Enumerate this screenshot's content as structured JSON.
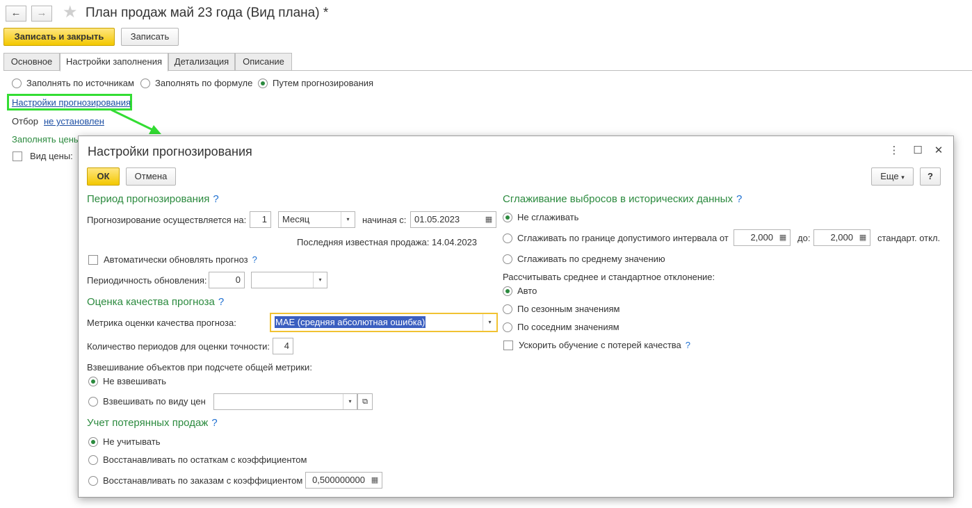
{
  "window": {
    "title": "План продаж май 23 года (Вид плана) *",
    "back_glyph": "←",
    "forward_glyph": "→",
    "star_glyph": "★"
  },
  "toolbar": {
    "save_close_label": "Записать и закрыть",
    "save_label": "Записать"
  },
  "tabs": [
    {
      "label": "Основное",
      "active": false
    },
    {
      "label": "Настройки заполнения",
      "active": true
    },
    {
      "label": "Детализация",
      "active": false
    },
    {
      "label": "Описание",
      "active": false
    }
  ],
  "fill_mode": {
    "options": [
      "Заполнять по источникам",
      "Заполнять по формуле",
      "Путем прогнозирования"
    ],
    "selected": 2
  },
  "forecast_settings_link": "Настройки прогнозирования",
  "filter": {
    "label": "Отбор",
    "value_link": "не установлен"
  },
  "fill_prices_label": "Заполнять цены",
  "price_type_label": "Вид цены:",
  "dialog": {
    "title": "Настройки прогнозирования",
    "more_glyph": "⋮",
    "maximize_glyph": "☐",
    "close_glyph": "✕",
    "ok_label": "ОК",
    "cancel_label": "Отмена",
    "more_label": "Еще",
    "more_arrow": "▾",
    "help_label": "?",
    "question_glyph": "?",
    "dropdown_glyph": "▾",
    "calc_glyph": "▦",
    "open_glyph": "⧉",
    "period": {
      "heading": "Период прогнозирования",
      "forecast_label": "Прогнозирование осуществляется на:",
      "count": "1",
      "unit": "Месяц",
      "start_label": "начиная с:",
      "start_date": "01.05.2023",
      "calendar_glyph": "▦",
      "last_sale": "Последняя известная продажа:  14.04.2023",
      "auto_update_label": "Автоматически обновлять прогноз",
      "update_period_label": "Периодичность обновления:",
      "update_period_value": "0",
      "update_period_unit": ""
    },
    "quality": {
      "heading": "Оценка качества прогноза",
      "metric_label": "Метрика оценки качества прогноза:",
      "metric_value": "MAE (средняя абсолютная ошибка)",
      "periods_label": "Количество периодов для оценки точности:",
      "periods_value": "4",
      "weighting_label": "Взвешивание объектов при подсчете общей метрики:",
      "weighting_options": [
        "Не взвешивать",
        "Взвешивать по виду цен"
      ],
      "weighting_selected": 0,
      "price_type_value": ""
    },
    "lost_sales": {
      "heading": "Учет потерянных продаж",
      "options": [
        "Не учитывать",
        "Восстанавливать по остаткам с коэффициентом",
        "Восстанавливать по заказам с коэффициентом"
      ],
      "selected": 0,
      "coefficient": "0,500000000"
    },
    "smoothing": {
      "heading": "Сглаживание выбросов в исторических данных",
      "options": [
        "Не сглаживать",
        "Сглаживать по границе допустимого интервала от",
        "Сглаживать по среднему значению"
      ],
      "selected": 0,
      "from_value": "2,000",
      "to_label": "до:",
      "to_value": "2,000",
      "unit_label": "стандарт. откл.",
      "calc_label": "Рассчитывать среднее и стандартное отклонение:",
      "calc_options": [
        "Авто",
        "По сезонным значениям",
        "По соседним значениям"
      ],
      "calc_selected": 0,
      "speedup_label": "Ускорить обучение с потерей качества"
    }
  },
  "colors": {
    "accent_green": "#2b8a3e",
    "link_blue": "#1d4fa3",
    "primary_button": "#f3c800",
    "highlight_green": "#33dd33"
  }
}
